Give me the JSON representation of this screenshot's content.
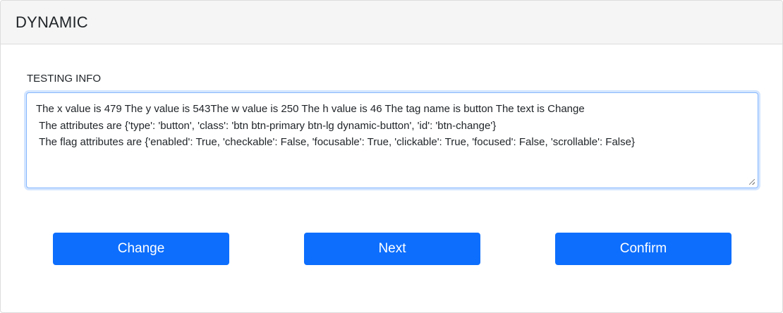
{
  "header": {
    "title": "DYNAMIC"
  },
  "testing_info": {
    "label": "TESTING INFO",
    "text": "The x value is 479 The y value is 543The w value is 250 The h value is 46 The tag name is button The text is Change\n The attributes are {'type': 'button', 'class': 'btn btn-primary btn-lg dynamic-button', 'id': 'btn-change'}\n The flag attributes are {'enabled': True, 'checkable': False, 'focusable': True, 'clickable': True, 'focused': False, 'scrollable': False}"
  },
  "buttons": {
    "change_label": "Change",
    "next_label": "Next",
    "confirm_label": "Confirm"
  },
  "colors": {
    "primary": "#0d6efd",
    "header_bg": "#f5f5f5",
    "focus_border": "#86b7fe"
  }
}
